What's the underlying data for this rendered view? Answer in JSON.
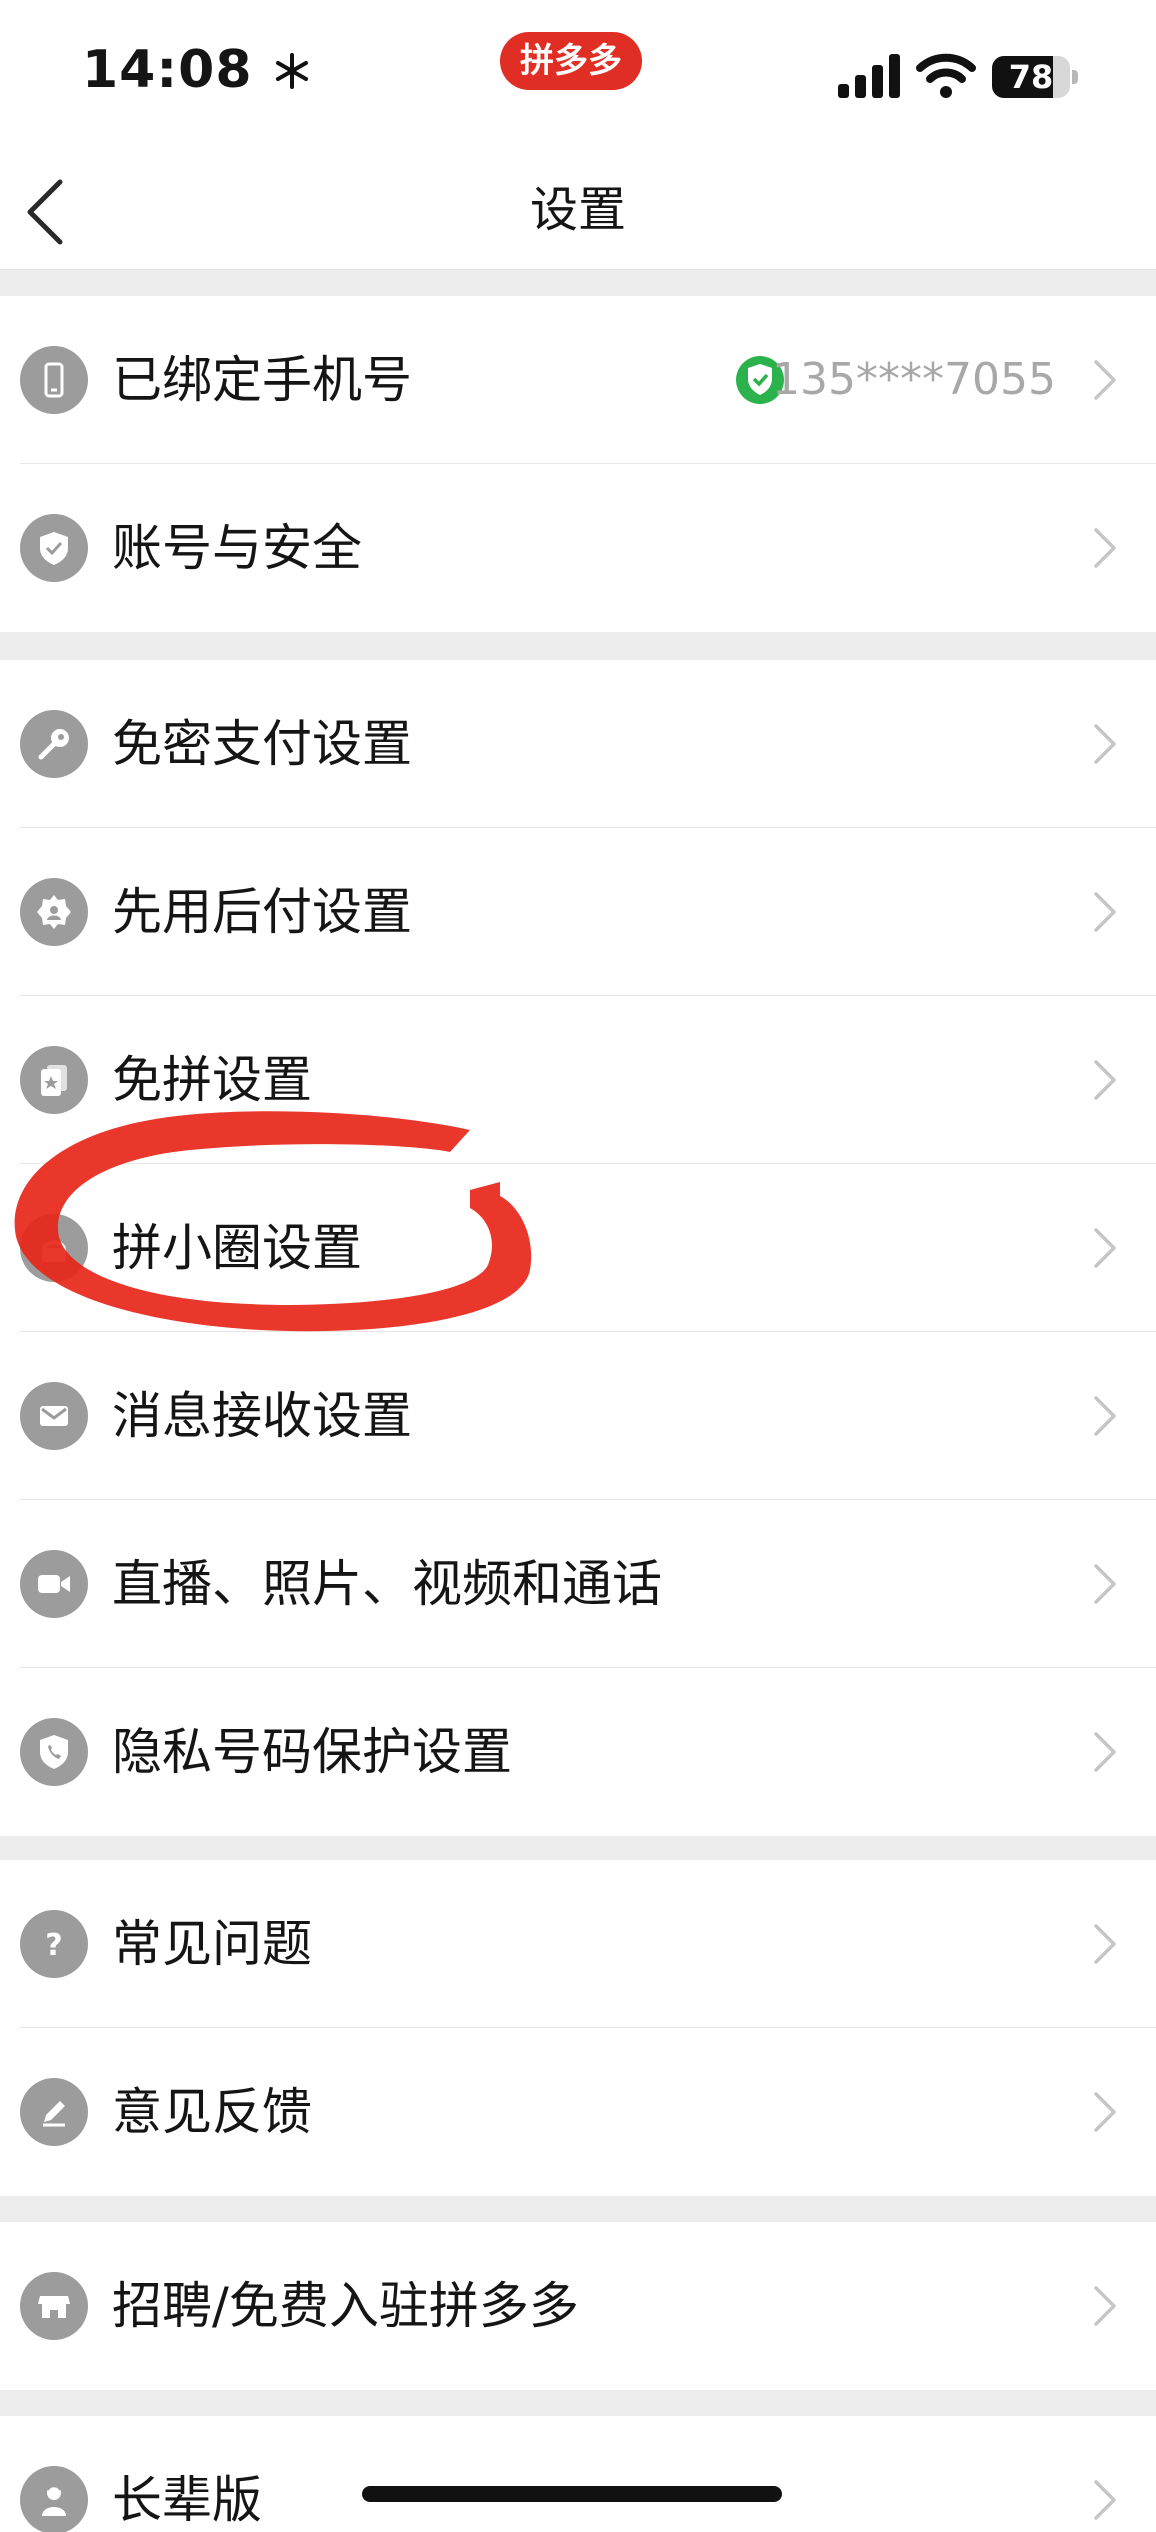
{
  "status_bar": {
    "time": "14:08",
    "time_icon": "snowflake-icon",
    "app_badge": "拼多多",
    "app_badge_color": "#e02e24",
    "battery_level": "78",
    "battery_fraction": 0.78
  },
  "nav": {
    "title": "设置",
    "back_icon": "chevron-left-icon"
  },
  "groups": [
    {
      "items": [
        {
          "name": "phone",
          "label": "已绑定手机号",
          "icon": "phone-icon",
          "value": "135****7055",
          "verified": true
        },
        {
          "name": "account-security",
          "label": "账号与安全",
          "icon": "shield-icon"
        }
      ]
    },
    {
      "items": [
        {
          "name": "password-free-pay",
          "label": "免密支付设置",
          "icon": "key-icon"
        },
        {
          "name": "pay-later",
          "label": "先用后付设置",
          "icon": "badge-icon"
        },
        {
          "name": "skip-group",
          "label": "免拼设置",
          "icon": "cards-icon"
        },
        {
          "name": "circle",
          "label": "拼小圈设置",
          "icon": "circle-icon"
        },
        {
          "name": "messages",
          "label": "消息接收设置",
          "icon": "mail-icon"
        },
        {
          "name": "media",
          "label": "直播、照片、视频和通话",
          "icon": "video-camera-icon"
        },
        {
          "name": "privacy-number",
          "label": "隐私号码保护设置",
          "icon": "phone-shield-icon"
        }
      ]
    },
    {
      "items": [
        {
          "name": "faq",
          "label": "常见问题",
          "icon": "question-icon"
        },
        {
          "name": "feedback",
          "label": "意见反馈",
          "icon": "pencil-icon"
        }
      ]
    },
    {
      "items": [
        {
          "name": "recruit",
          "label": "招聘/免费入驻拼多多",
          "icon": "store-icon"
        }
      ]
    },
    {
      "items": [
        {
          "name": "elder-mode",
          "label": "长辈版",
          "icon": "elder-icon"
        }
      ]
    }
  ],
  "colors": {
    "verified": "#2bb24c",
    "annotation": "#e8261a",
    "icon_bg": "#9c9c9c"
  }
}
